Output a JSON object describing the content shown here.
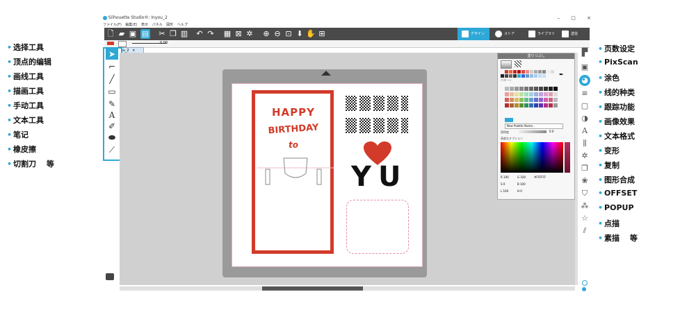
{
  "window": {
    "title": "Silhouette Studio®: Inyou_2",
    "menu": [
      "ファイル(F)",
      "編集(E)",
      "表示",
      "パネル",
      "図形",
      "ヘルプ"
    ],
    "controls": [
      "–",
      "▢",
      "×"
    ],
    "doc_tab": "Inyou_2",
    "zoom_value": "0.00",
    "tabs": [
      "デザイン",
      "ストア",
      "ライブラリ",
      "送信"
    ]
  },
  "left_annotations": [
    "选择工具",
    "顶点的编辑",
    "画线工具",
    "描画工具",
    "手动工具",
    "文本工具",
    "笔记",
    "橡皮擦",
    "切割刀　 等"
  ],
  "right_annotations": [
    "页数设定",
    "PixScan",
    "涂色",
    "线的种类",
    "跟踪功能",
    "画像效果",
    "文本格式",
    "变形",
    "复制",
    "图形合成",
    "OFFSET",
    "POPUP",
    "点描",
    "素描　 等"
  ],
  "design": {
    "happy": "HAPPY",
    "birthday": "BIRTHDAY",
    "to": "to",
    "yu": "YU"
  },
  "panel": {
    "title": "塗りつぶし",
    "pattern_label": "パターン",
    "palette_label": "New Palette Name...",
    "opacity_label": "透明度",
    "opacity_value": "0.0",
    "advanced_label": "高度なオプション",
    "r": "R 100",
    "g": "G 100",
    "b": "B 100",
    "h": "H 0",
    "s": "S 0",
    "l": "L 100",
    "hex": "#FFFFFF"
  },
  "colors": {
    "accent": "#2ea8d6",
    "red": "#d23b2a",
    "toolbar": "#4a4a4a"
  }
}
